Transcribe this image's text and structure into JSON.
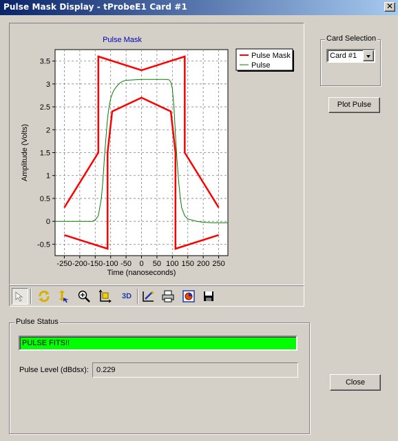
{
  "window": {
    "title": "Pulse Mask Display - tProbeE1 Card #1",
    "close_glyph": "✕"
  },
  "chart_data": {
    "type": "line",
    "title": "Pulse Mask",
    "xlabel": "Time (nanoseconds)",
    "ylabel": "Amplitude (Volts)",
    "xlim": [
      -280,
      280
    ],
    "ylim": [
      -0.75,
      3.75
    ],
    "xticks": [
      -250,
      -200,
      -150,
      -100,
      -50,
      0,
      50,
      100,
      150,
      200,
      250
    ],
    "yticks": [
      -0.5,
      0,
      0.5,
      1,
      1.5,
      2,
      2.5,
      3,
      3.5
    ],
    "grid": true,
    "legend_position": "top-right",
    "series": [
      {
        "name": "Pulse Mask",
        "color": "#ff0000",
        "segments": [
          [
            [
              -250,
              0.3
            ],
            [
              -140,
              1.5
            ],
            [
              -140,
              3.6
            ],
            [
              0,
              3.3
            ],
            [
              140,
              3.6
            ],
            [
              140,
              1.5
            ],
            [
              250,
              0.3
            ]
          ],
          [
            [
              -250,
              -0.3
            ],
            [
              -110,
              -0.6
            ],
            [
              -110,
              1.5
            ],
            [
              -95,
              2.4
            ],
            [
              0,
              2.7
            ],
            [
              95,
              2.4
            ],
            [
              110,
              1.5
            ],
            [
              110,
              -0.6
            ],
            [
              250,
              -0.3
            ]
          ]
        ]
      },
      {
        "name": "Pulse",
        "color": "#008000",
        "segments": [
          [
            [
              -280,
              0
            ],
            [
              -160,
              0
            ],
            [
              -150,
              0.03
            ],
            [
              -140,
              0.12
            ],
            [
              -130,
              0.5
            ],
            [
              -125,
              0.9
            ],
            [
              -120,
              1.4
            ],
            [
              -115,
              1.85
            ],
            [
              -110,
              2.25
            ],
            [
              -105,
              2.5
            ],
            [
              -100,
              2.68
            ],
            [
              -95,
              2.78
            ],
            [
              -90,
              2.86
            ],
            [
              -80,
              2.95
            ],
            [
              -70,
              3.02
            ],
            [
              -60,
              3.06
            ],
            [
              -50,
              3.08
            ],
            [
              0,
              3.1
            ],
            [
              80,
              3.1
            ],
            [
              90,
              3.09
            ],
            [
              95,
              3.04
            ],
            [
              100,
              2.9
            ],
            [
              105,
              2.5
            ],
            [
              110,
              1.9
            ],
            [
              115,
              1.35
            ],
            [
              120,
              0.9
            ],
            [
              125,
              0.55
            ],
            [
              130,
              0.3
            ],
            [
              140,
              0.12
            ],
            [
              150,
              0.05
            ],
            [
              180,
              0.0
            ],
            [
              200,
              -0.02
            ],
            [
              230,
              -0.03
            ],
            [
              280,
              -0.03
            ]
          ]
        ]
      }
    ]
  },
  "toolbar": {
    "buttons": [
      {
        "name": "select-arrow-icon",
        "pressed": true
      },
      {
        "name": "rotate-icon"
      },
      {
        "name": "pan-icon"
      },
      {
        "name": "zoom-icon"
      },
      {
        "name": "axis-scale-icon"
      },
      {
        "name": "3d-toggle-icon",
        "text": "3D"
      },
      {
        "name": "edit-chart-icon"
      },
      {
        "name": "print-icon"
      },
      {
        "name": "export-icon"
      },
      {
        "name": "save-icon"
      }
    ]
  },
  "card_selection": {
    "label": "Card Selection",
    "value": "Card #1"
  },
  "buttons": {
    "plot_pulse": "Plot Pulse",
    "close": "Close"
  },
  "pulse_status": {
    "label": "Pulse Status",
    "result": "PULSE FITS!!",
    "result_color": "#00ff00",
    "level_label": "Pulse Level (dBdsx):",
    "level_value": "0.229"
  }
}
